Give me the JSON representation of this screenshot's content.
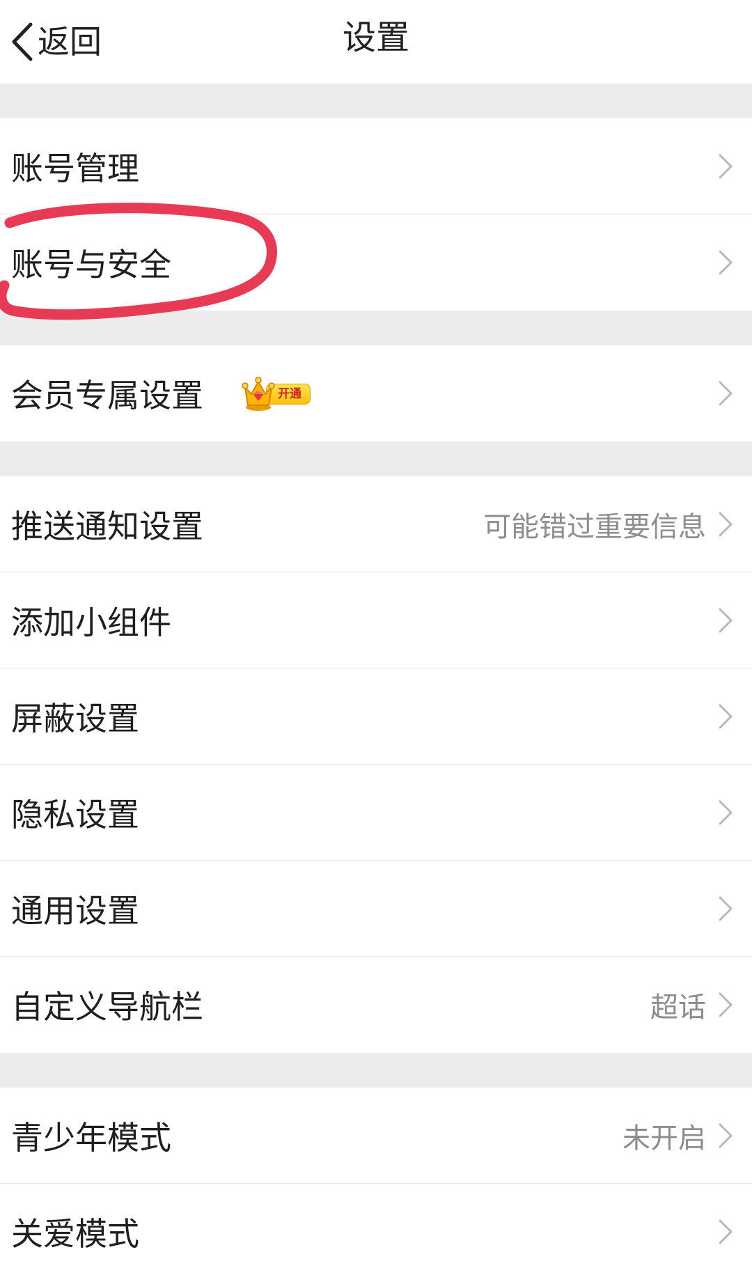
{
  "header": {
    "back_label": "返回",
    "title": "设置"
  },
  "rows": {
    "account_management": {
      "label": "账号管理"
    },
    "account_security": {
      "label": "账号与安全"
    },
    "vip_settings": {
      "label": "会员专属设置",
      "badge": "开通"
    },
    "push_notifications": {
      "label": "推送通知设置",
      "value": "可能错过重要信息"
    },
    "add_widget": {
      "label": "添加小组件"
    },
    "block_settings": {
      "label": "屏蔽设置"
    },
    "privacy_settings": {
      "label": "隐私设置"
    },
    "general_settings": {
      "label": "通用设置"
    },
    "custom_nav_bar": {
      "label": "自定义导航栏",
      "value": "超话"
    },
    "teen_mode": {
      "label": "青少年模式",
      "value": "未开启"
    },
    "care_mode": {
      "label": "关爱模式"
    }
  },
  "colors": {
    "background": "#ffffff",
    "section_gap": "#ececec",
    "divider": "#e6e6e6",
    "secondary_text": "#8d8d8d",
    "highlight_annotation": "#e83a55",
    "vip_badge": "#ffc20a"
  }
}
